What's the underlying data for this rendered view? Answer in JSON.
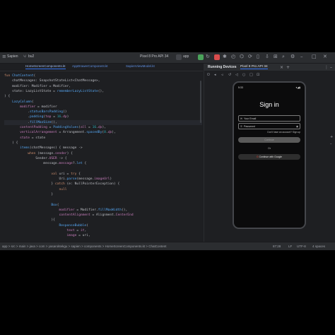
{
  "toolbar": {
    "project": "Sapien",
    "branch": "bu2",
    "device": "Pixel 8 Pro API 34",
    "run_config": "app"
  },
  "editor_tabs": [
    {
      "label": "HomeScreenComponents.kt",
      "active": true
    },
    {
      "label": "AppDrawerComponent.kt",
      "active": false
    },
    {
      "label": "SapienViewModel.kt",
      "active": false
    }
  ],
  "code_lines": [
    "fun ChatContent(",
    "    chatMessages: SnapshotStateList<ChatMessage>,",
    "    modifier: Modifier = Modifier,",
    "    state: LazyListState = rememberLazyListState(),",
    ") {",
    "    LazyColumn(",
    "        modifier = modifier",
    "            .statusBarsPadding()",
    "            .padding(top = 16.dp)",
    "            .fillMaxSize(),",
    "        contentPadding = PaddingValues(all = 16.dp),",
    "        verticalArrangement = Arrangement.spacedBy(8.dp),",
    "        state = state",
    "    ) {",
    "        items(chatMessages) { message ->",
    "            when (message.sender) {",
    "                Sender.USER -> {",
    "                    message.message?.let {",
    "",
    "                        val uri = try {",
    "                            Uri.parse(message.imageUrl)",
    "                        } catch (e: NullPointerException) {",
    "                            null",
    "                        }",
    "",
    "                        Box(",
    "                            modifier = Modifier.fillMaxWidth(),",
    "                            contentAlignment = Alignment.CenterEnd",
    "                        ){",
    "                            ResponseBubble(",
    "                                text = it,",
    "                                image = uri,"
  ],
  "running_devices": {
    "title": "Running Devices",
    "device_tab": "Pixel 8 Pro API 34"
  },
  "phone": {
    "time": "5:33",
    "title": "Sign in",
    "email_placeholder": "Your Email",
    "password_placeholder": "Password",
    "forgot": "Don't have an account? Sign up",
    "signin_button": "Continue",
    "or_text": "Or",
    "google_button": "Continue with Google"
  },
  "statusbar": {
    "path": "app  >  src  >  main  >  java  >  com  >  yasaroktekgu  >  sapien  >  components  >  HomeScreenComponents.kt  >  ChatContent",
    "position": "87:28",
    "line_sep": "LF",
    "encoding": "UTF-8",
    "indent": "4 spaces"
  },
  "colors": {
    "accent": "#3574f0",
    "editor_bg": "#1e1f22",
    "keyword": "#cf8e6d",
    "function": "#56a8f5"
  }
}
